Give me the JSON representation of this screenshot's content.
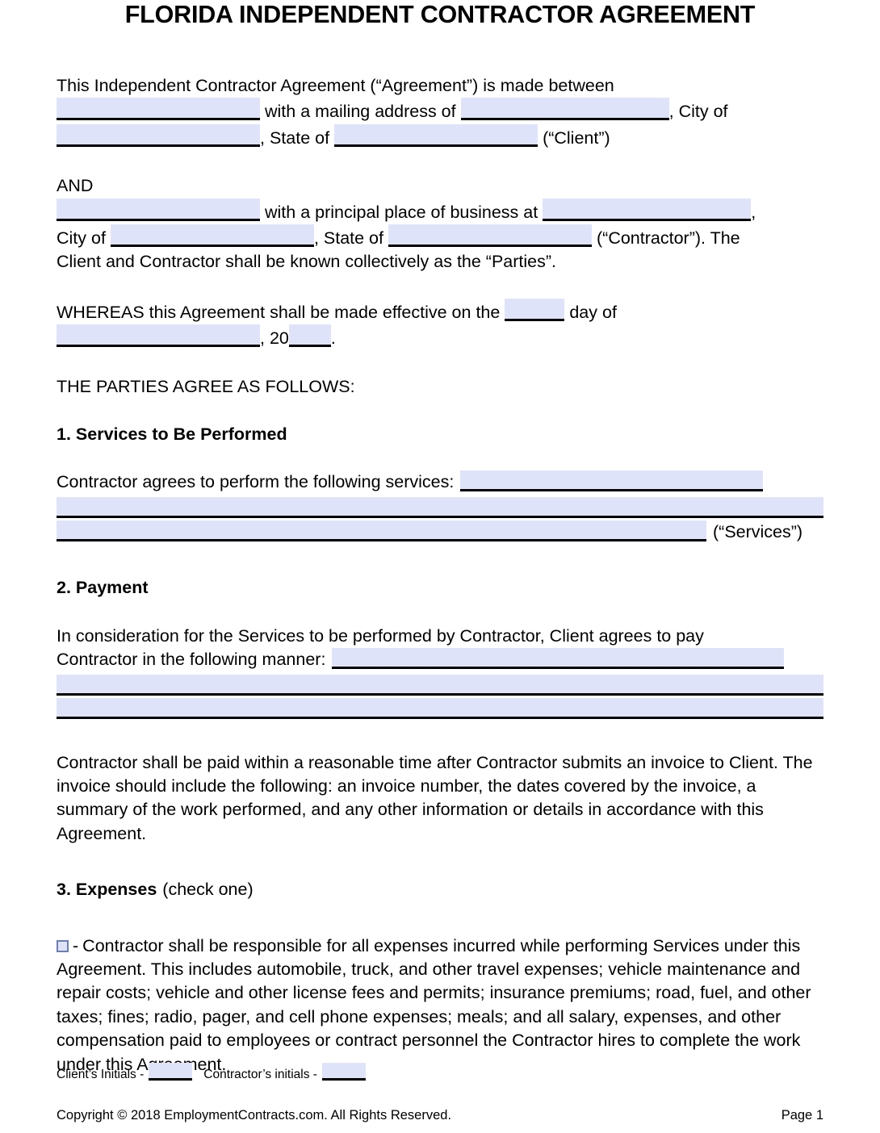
{
  "document": {
    "title": "FLORIDA INDEPENDENT CONTRACTOR AGREEMENT"
  },
  "intro": {
    "line1": "This Independent Contractor Agreement (“Agreement”) is made between",
    "with_mailing_address_of": "with a mailing address of",
    "comma_city_of": ", City of",
    "comma_state_of": ", State of",
    "client_label": "(“Client”)"
  },
  "and_block": {
    "and": "AND",
    "with_principal_place": "with a principal place of business at",
    "trailing_comma": ",",
    "city_of": "City of",
    "comma_state_of": ", State of",
    "contractor_label": "(“Contractor”). The",
    "parties_line": "Client and Contractor shall be known collectively as the “Parties”."
  },
  "whereas": {
    "part1": "WHEREAS this Agreement shall be made effective on the",
    "day_of": "day of",
    "comma_20": ", 20",
    "period": "."
  },
  "agree_intro": "THE PARTIES AGREE AS FOLLOWS:",
  "sections": {
    "services": {
      "number_title": "1. Services to Be Performed",
      "lead_in": "Contractor agrees to perform the following services:",
      "services_label": "(“Services”)"
    },
    "payment": {
      "number_title": "2. Payment",
      "lead_in_line1": "In consideration for the Services to be performed by Contractor, Client agrees to pay",
      "lead_in_line2": "Contractor in the following manner:",
      "invoice_paragraph": "Contractor shall be paid within a reasonable time after Contractor submits an invoice to Client. The invoice should include the following: an invoice number, the dates covered by the invoice, a summary of the work performed, and any other information or details in accordance with this Agreement."
    },
    "expenses": {
      "number_title": "3. Expenses",
      "check_one": "(check one)",
      "option_dash": "-",
      "option_text": "Contractor shall be responsible for all expenses incurred while performing Services under this Agreement. This includes automobile, truck, and other travel expenses; vehicle maintenance and repair costs; vehicle and other license fees and permits; insurance premiums; road, fuel, and other taxes; fines; radio, pager, and cell phone expenses; meals; and all salary, expenses, and other compensation paid to employees or contract personnel the Contractor hires to complete the work under this Agreement."
    }
  },
  "footer": {
    "client_initials_label": "Client’s Initials -",
    "contractor_initials_label": "Contractor’s initials -",
    "copyright": "Copyright © 2018 EmploymentContracts.com. All Rights Reserved.",
    "page_number": "Page 1"
  },
  "colors": {
    "field_fill": "#dfe3fa",
    "field_underline": "#000000",
    "checkbox_border": "#6b7fb5",
    "text": "#000000",
    "page_background": "#ffffff"
  }
}
